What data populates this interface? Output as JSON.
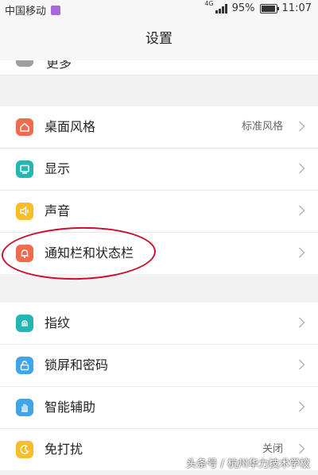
{
  "status_bar": {
    "carrier": "中国移动",
    "network": "4G",
    "battery_percent": "95%",
    "battery_level": 0.95,
    "time": "11:07"
  },
  "header": {
    "title": "设置"
  },
  "partial_item": {
    "label": "更多"
  },
  "groups": [
    {
      "items": [
        {
          "label": "桌面风格",
          "value": "标准风格",
          "icon": "home-icon",
          "color": "#f06a4d"
        },
        {
          "label": "显示",
          "value": "",
          "icon": "display-icon",
          "color": "#22b7b0"
        },
        {
          "label": "声音",
          "value": "",
          "icon": "speaker-icon",
          "color": "#f7bd2a"
        },
        {
          "label": "通知栏和状态栏",
          "value": "",
          "icon": "bell-icon",
          "color": "#f06a4d"
        }
      ]
    },
    {
      "items": [
        {
          "label": "指纹",
          "value": "",
          "icon": "fingerprint-icon",
          "color": "#22b7b0"
        },
        {
          "label": "锁屏和密码",
          "value": "",
          "icon": "lock-icon",
          "color": "#3fa4e8"
        },
        {
          "label": "智能辅助",
          "value": "",
          "icon": "hand-icon",
          "color": "#3fa4e8"
        },
        {
          "label": "免打扰",
          "value": "关闭",
          "icon": "moon-icon",
          "color": "#f7bd2a"
        }
      ]
    }
  ],
  "watermark": "头条号 / 杭州华力技术学校"
}
